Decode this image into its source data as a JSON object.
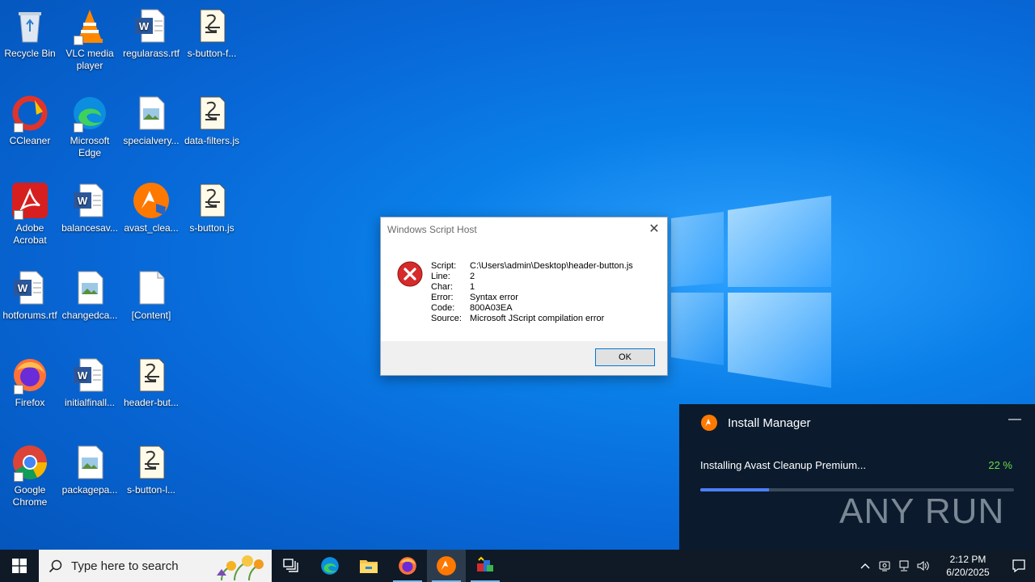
{
  "desktop": {
    "icons": [
      {
        "label": "Recycle Bin",
        "icon": "recycle-bin-icon"
      },
      {
        "label": "VLC media player",
        "icon": "vlc-icon"
      },
      {
        "label": "regularass.rtf",
        "icon": "word-document-icon"
      },
      {
        "label": "s-button-f...",
        "icon": "script-file-icon"
      },
      {
        "label": "CCleaner",
        "icon": "ccleaner-icon"
      },
      {
        "label": "Microsoft Edge",
        "icon": "edge-icon"
      },
      {
        "label": "specialvery...",
        "icon": "image-file-icon"
      },
      {
        "label": "data-filters.js",
        "icon": "script-file-icon"
      },
      {
        "label": "Adobe Acrobat",
        "icon": "acrobat-icon"
      },
      {
        "label": "balancesav...",
        "icon": "word-document-icon"
      },
      {
        "label": "avast_clea...",
        "icon": "avast-icon"
      },
      {
        "label": "s-button.js",
        "icon": "script-file-icon"
      },
      {
        "label": "hotforums.rtf",
        "icon": "word-document-icon"
      },
      {
        "label": "changedca...",
        "icon": "image-file-icon"
      },
      {
        "label": "[Content]",
        "icon": "blank-file-icon"
      },
      {
        "label": "Firefox",
        "icon": "firefox-icon"
      },
      {
        "label": "initialfinall...",
        "icon": "word-document-icon"
      },
      {
        "label": "header-but...",
        "icon": "script-file-icon"
      },
      {
        "label": "Google Chrome",
        "icon": "chrome-icon"
      },
      {
        "label": "packagepa...",
        "icon": "image-file-icon"
      },
      {
        "label": "s-button-l...",
        "icon": "script-file-icon"
      }
    ]
  },
  "dialog": {
    "title": "Windows Script Host",
    "rows": [
      {
        "key": "Script:",
        "value": "C:\\Users\\admin\\Desktop\\header-button.js"
      },
      {
        "key": "Line:",
        "value": "2"
      },
      {
        "key": "Char:",
        "value": "1"
      },
      {
        "key": "Error:",
        "value": "Syntax error"
      },
      {
        "key": "Code:",
        "value": "800A03EA"
      },
      {
        "key": "Source:",
        "value": "Microsoft JScript compilation error"
      }
    ],
    "ok_label": "OK"
  },
  "install_manager": {
    "title": "Install Manager",
    "status": "Installing Avast Cleanup Premium...",
    "percent_label": "22 %",
    "progress": 0.22,
    "watermark": "ANY RUN"
  },
  "taskbar": {
    "search_placeholder": "Type here to search",
    "clock_time": "2:12 PM",
    "clock_date": "6/20/2025"
  },
  "colors": {
    "accent": "#0078d7",
    "progress_fill": "#4d7eff",
    "percent_green": "#6fda48",
    "install_bg": "#0b1b2d"
  }
}
